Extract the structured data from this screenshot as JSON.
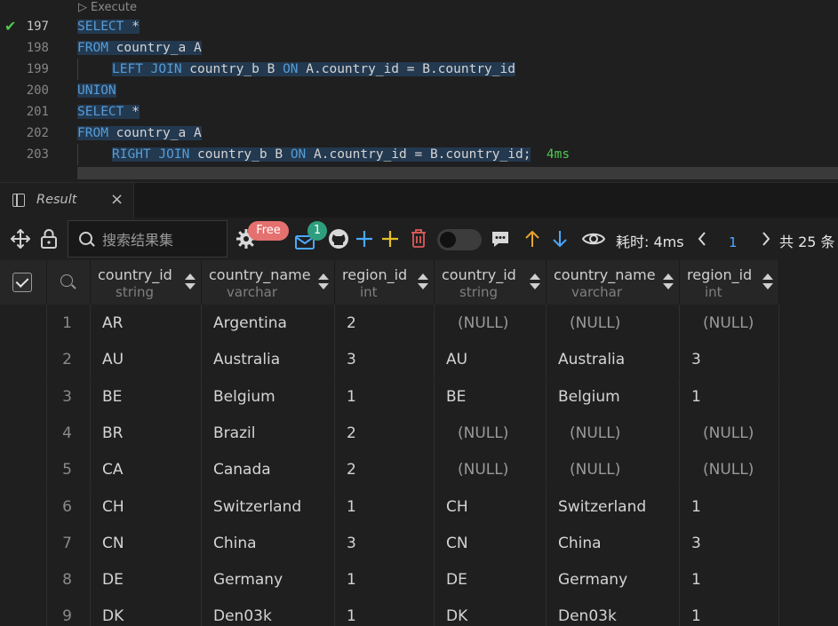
{
  "editor": {
    "codelens": "Execute",
    "lines": [
      {
        "num": "197",
        "ok": true,
        "parts": [
          [
            "kw",
            "SELECT"
          ],
          [
            "t",
            " *"
          ]
        ],
        "indent": false
      },
      {
        "num": "198",
        "parts": [
          [
            "kw",
            "FROM"
          ],
          [
            "t",
            " country_a A"
          ]
        ],
        "indent": false
      },
      {
        "num": "199",
        "parts": [
          [
            "kw",
            "LEFT JOIN"
          ],
          [
            "t",
            " country_b B "
          ],
          [
            "kw",
            "ON"
          ],
          [
            "t",
            " A.country_id = B.country_id"
          ]
        ],
        "indent": true
      },
      {
        "num": "200",
        "parts": [
          [
            "kw",
            "UNION"
          ]
        ],
        "indent": false
      },
      {
        "num": "201",
        "parts": [
          [
            "kw",
            "SELECT"
          ],
          [
            "t",
            " *"
          ]
        ],
        "indent": false
      },
      {
        "num": "202",
        "parts": [
          [
            "kw",
            "FROM"
          ],
          [
            "t",
            " country_a A"
          ]
        ],
        "indent": false
      },
      {
        "num": "203",
        "parts": [
          [
            "kw",
            "RIGHT JOIN"
          ],
          [
            "t",
            " country_b B "
          ],
          [
            "kw",
            "ON"
          ],
          [
            "t",
            " A.country_id = B.country_id;"
          ]
        ],
        "indent": true,
        "time": "4ms"
      }
    ]
  },
  "result_tab": {
    "label": "Result",
    "close": "×"
  },
  "toolbar": {
    "search_placeholder": "搜索结果集",
    "free_badge": "Free",
    "mail_count": "1",
    "time_label": "耗时: 4ms",
    "page": "1",
    "total": "共 25 条",
    "icons": [
      "move-icon",
      "lock-icon",
      "search-icon",
      "gear-icon",
      "mail-icon",
      "github-icon",
      "plus-icon",
      "plus-yellow-icon",
      "trash-icon",
      "toggle",
      "comment-icon",
      "arrow-up-icon",
      "arrow-down-icon",
      "eye-icon",
      "chevron-left-icon",
      "chevron-right-icon"
    ]
  },
  "table": {
    "columns": [
      {
        "name": "country_id",
        "type": "string"
      },
      {
        "name": "country_name",
        "type": "varchar"
      },
      {
        "name": "region_id",
        "type": "int"
      },
      {
        "name": "country_id",
        "type": "string"
      },
      {
        "name": "country_name",
        "type": "varchar"
      },
      {
        "name": "region_id",
        "type": "int"
      }
    ],
    "rows": [
      [
        "1",
        "AR",
        "Argentina",
        "2",
        "(NULL)",
        "(NULL)",
        "(NULL)"
      ],
      [
        "2",
        "AU",
        "Australia",
        "3",
        "AU",
        "Australia",
        "3"
      ],
      [
        "3",
        "BE",
        "Belgium",
        "1",
        "BE",
        "Belgium",
        "1"
      ],
      [
        "4",
        "BR",
        "Brazil",
        "2",
        "(NULL)",
        "(NULL)",
        "(NULL)"
      ],
      [
        "5",
        "CA",
        "Canada",
        "2",
        "(NULL)",
        "(NULL)",
        "(NULL)"
      ],
      [
        "6",
        "CH",
        "Switzerland",
        "1",
        "CH",
        "Switzerland",
        "1"
      ],
      [
        "7",
        "CN",
        "China",
        "3",
        "CN",
        "China",
        "3"
      ],
      [
        "8",
        "DE",
        "Germany",
        "1",
        "DE",
        "Germany",
        "1"
      ],
      [
        "9",
        "DK",
        "Den03k",
        "1",
        "DK",
        "Den03k",
        "1"
      ]
    ]
  },
  "colors": {
    "keyword": "#569cd6",
    "success": "#4ec94e",
    "accent": "#4aa8ff",
    "free_badge": "#e4716f",
    "count_badge": "#2f9e7e"
  }
}
